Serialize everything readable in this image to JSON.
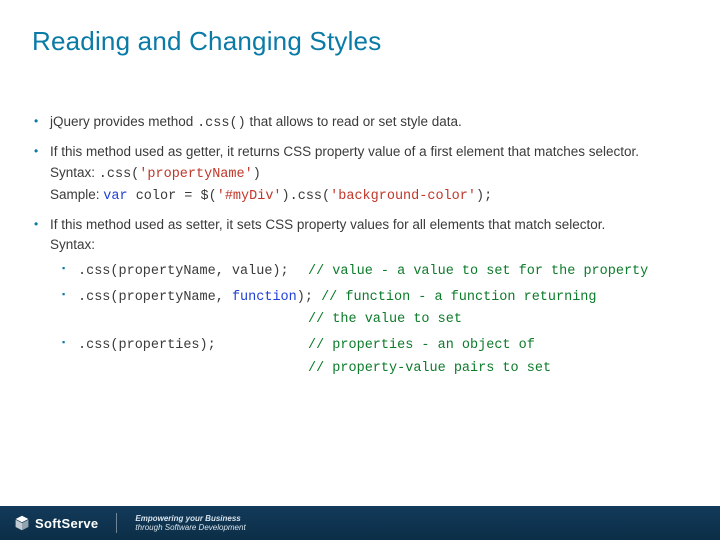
{
  "title": "Reading and Changing Styles",
  "b1": {
    "t1": "jQuery provides method ",
    "code": ".css()",
    "t2": " that allows to read or set style data."
  },
  "b2": {
    "t1": "If this method used as getter, it returns CSS property value of a first element that matches selector.",
    "syntaxLabel": "Syntax: ",
    "syntaxCode": ".css(",
    "propName": "'propertyName'",
    "syntaxEnd": ")",
    "sampleLabel": "Sample: ",
    "var": "var",
    "sampleMid": " color = $(",
    "sel": "'#myDiv'",
    "sampleMid2": ").css(",
    "bg": "'background-color'",
    "sampleEnd": ");"
  },
  "b3": {
    "t1": "If this method used as setter, it sets CSS property values for all elements that match selector.",
    "syntaxLabel": "Syntax:",
    "s1a": ".css(propertyName, value);",
    "s1c": "// value - a value to set for the property",
    "s2a": ".css(propertyName, ",
    "s2fn": "function",
    "s2b": "); ",
    "s2c1": "// function - a function returning",
    "s2c2": "// the value to set",
    "s3a": ".css(properties);",
    "s3c1": "// properties - an object of",
    "s3c2": "// property-value pairs to set"
  },
  "footer": {
    "brand": "SoftServe",
    "tag1": "Empowering your Business",
    "tag2": "through Software Development"
  }
}
